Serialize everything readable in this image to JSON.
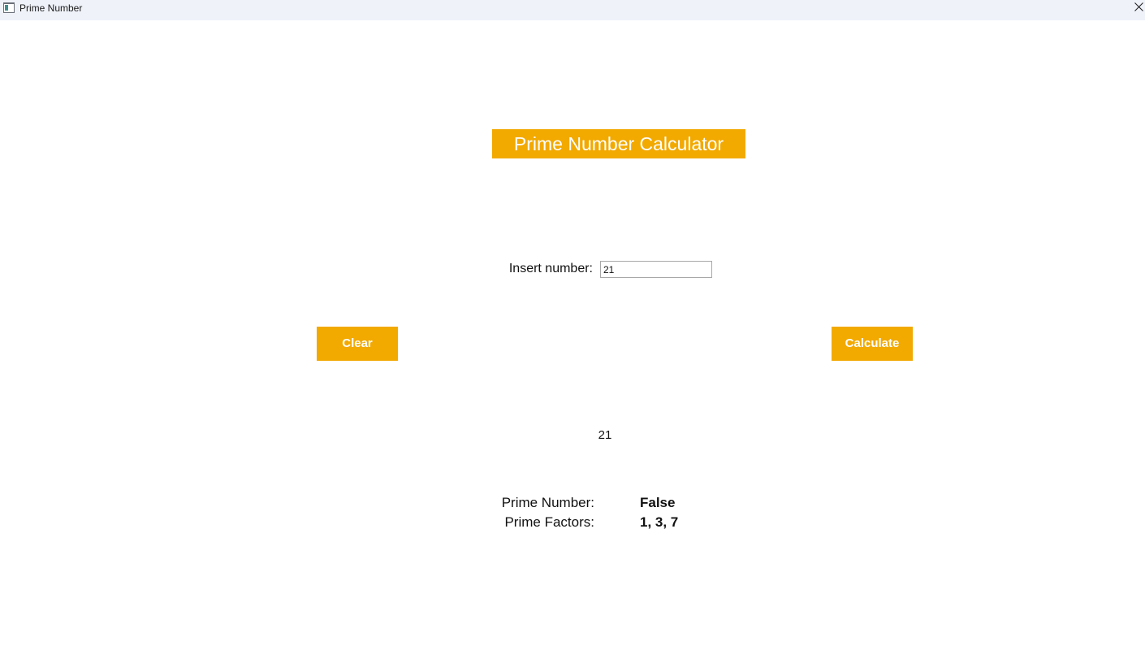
{
  "window": {
    "title": "Prime Number",
    "icons": {
      "app": "app-window-icon",
      "close": "close-icon"
    }
  },
  "header": {
    "title": "Prime Number Calculator"
  },
  "form": {
    "insert_label": "Insert number:",
    "input_value": "21"
  },
  "buttons": {
    "clear_label": "Clear",
    "calculate_label": "Calculate"
  },
  "result": {
    "echo_value": "21",
    "prime_label": "Prime Number:",
    "prime_value": "False",
    "factors_label": "Prime Factors:",
    "factors_value": "1, 3, 7"
  },
  "colors": {
    "accent": "#f2a900",
    "titlebar": "#eff2f9",
    "button_text": "#ffffff"
  }
}
